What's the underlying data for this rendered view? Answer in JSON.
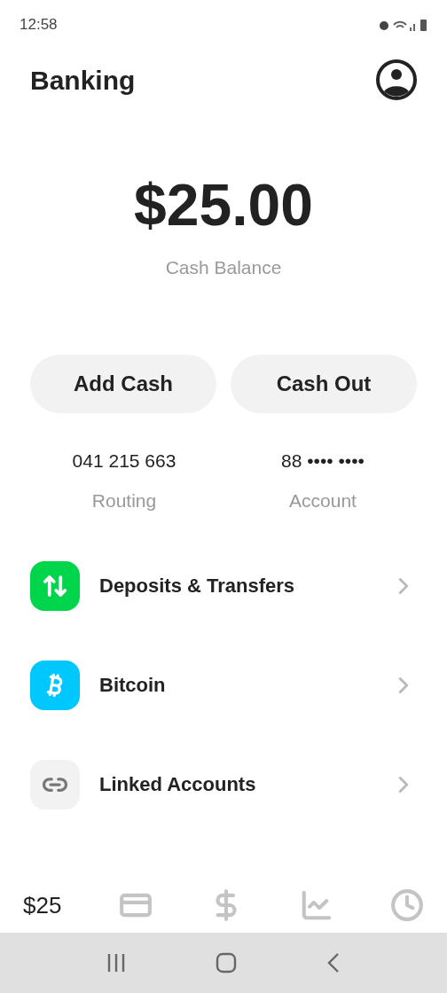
{
  "status_bar": {
    "time": "12:58"
  },
  "header": {
    "title": "Banking"
  },
  "balance": {
    "amount": "$25.00",
    "label": "Cash Balance"
  },
  "actions": [
    "Add Cash",
    "Cash Out"
  ],
  "account_numbers": [
    {
      "value": "041 215 663",
      "label": "Routing"
    },
    {
      "value": "88 •••• ••••",
      "label": "Account"
    }
  ],
  "menu": [
    {
      "kind": "transfers",
      "label": "Deposits & Transfers",
      "color": "#00d54b"
    },
    {
      "kind": "bitcoin",
      "label": "Bitcoin",
      "color": "#00c8ff"
    },
    {
      "kind": "link",
      "label": "Linked Accounts",
      "color": "#f2f2f2"
    }
  ],
  "tab_bar": [
    {
      "kind": "balance",
      "label": "$25",
      "selected": true
    },
    {
      "kind": "card",
      "selected": false
    },
    {
      "kind": "cash",
      "selected": false
    },
    {
      "kind": "investing",
      "selected": false
    },
    {
      "kind": "activity",
      "selected": false
    }
  ]
}
